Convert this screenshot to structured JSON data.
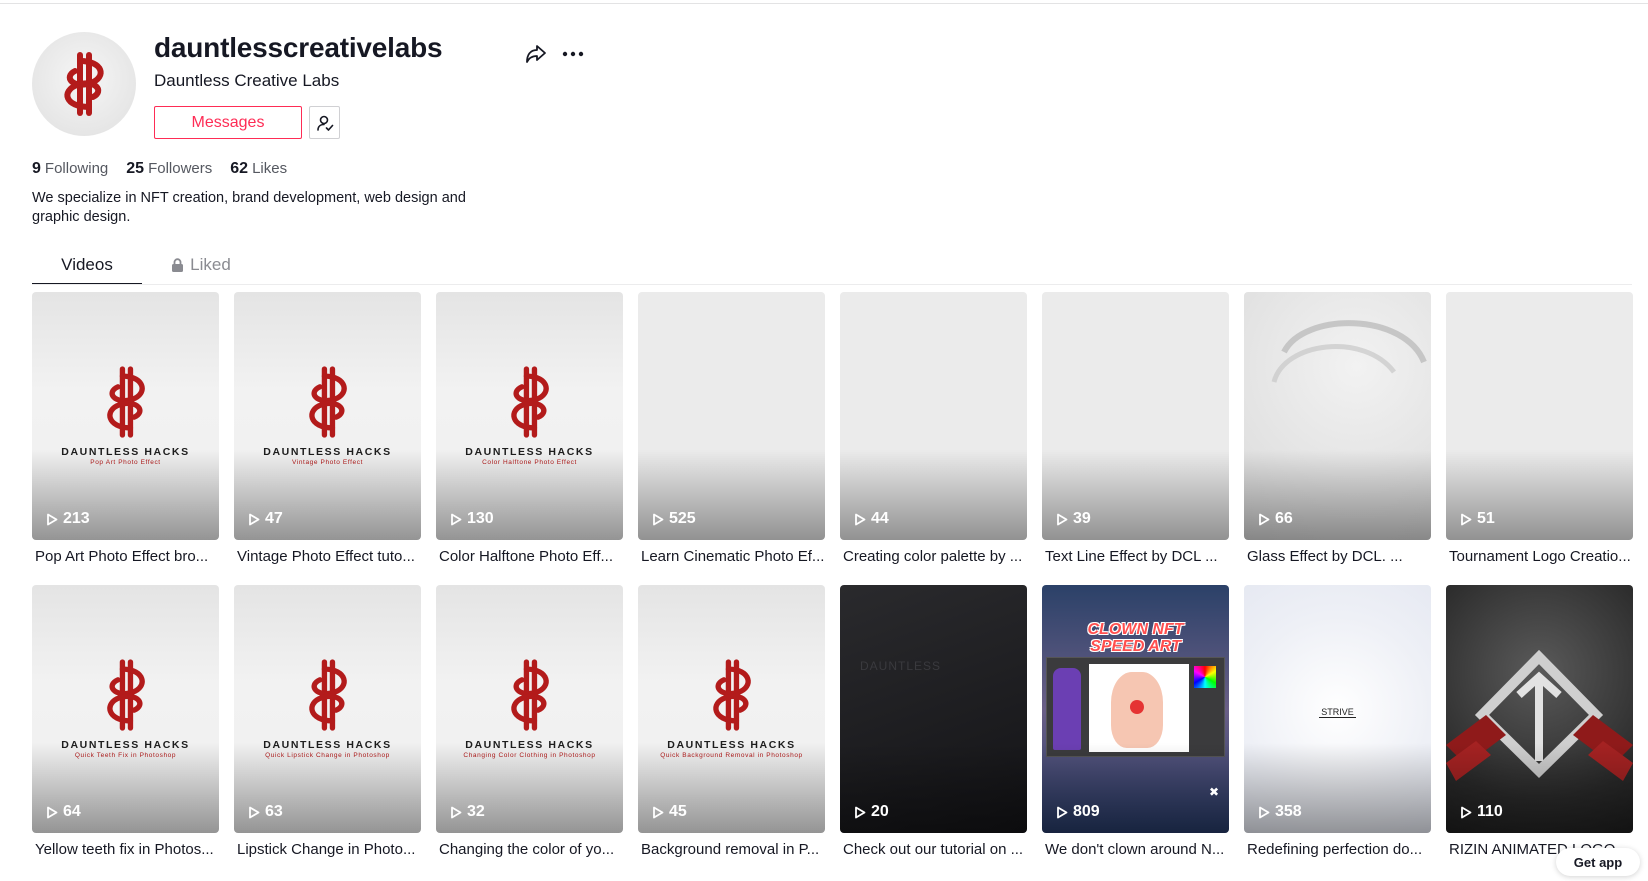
{
  "profile": {
    "username": "dauntlesscreativelabs",
    "display_name": "Dauntless Creative Labs",
    "messages_label": "Messages",
    "stats": {
      "following": {
        "count": "9",
        "label": "Following"
      },
      "followers": {
        "count": "25",
        "label": "Followers"
      },
      "likes": {
        "count": "62",
        "label": "Likes"
      }
    },
    "bio": "We specialize in NFT creation, brand development, web design and graphic design."
  },
  "tabs": {
    "videos": "Videos",
    "liked": "Liked"
  },
  "videos": [
    {
      "views": "213",
      "caption": "Pop Art Photo Effect bro...",
      "thumb": "light",
      "brand": "DAUNTLESS HACKS",
      "subtitle": "Pop Art Photo Effect"
    },
    {
      "views": "47",
      "caption": "Vintage Photo Effect tuto...",
      "thumb": "light",
      "brand": "DAUNTLESS HACKS",
      "subtitle": "Vintage Photo Effect"
    },
    {
      "views": "130",
      "caption": "Color Halftone Photo Eff...",
      "thumb": "light",
      "brand": "DAUNTLESS HACKS",
      "subtitle": "Color Halftone Photo Effect"
    },
    {
      "views": "525",
      "caption": "Learn Cinematic Photo Ef...",
      "thumb": "blank"
    },
    {
      "views": "44",
      "caption": "Creating color palette by ...",
      "thumb": "blank"
    },
    {
      "views": "39",
      "caption": "Text Line Effect by DCL ...",
      "thumb": "blank"
    },
    {
      "views": "66",
      "caption": "Glass Effect by DCL. ...",
      "thumb": "glass"
    },
    {
      "views": "51",
      "caption": "Tournament Logo Creatio...",
      "thumb": "blank"
    },
    {
      "views": "64",
      "caption": "Yellow teeth fix in Photos...",
      "thumb": "light",
      "brand": "DAUNTLESS HACKS",
      "subtitle": "Quick Teeth Fix in Photoshop"
    },
    {
      "views": "63",
      "caption": "Lipstick Change in Photo...",
      "thumb": "light",
      "brand": "DAUNTLESS HACKS",
      "subtitle": "Quick Lipstick Change in Photoshop"
    },
    {
      "views": "32",
      "caption": "Changing the color of yo...",
      "thumb": "light",
      "brand": "DAUNTLESS HACKS",
      "subtitle": "Changing Color Clothing in Photoshop"
    },
    {
      "views": "45",
      "caption": "Background removal in P...",
      "thumb": "light",
      "brand": "DAUNTLESS HACKS",
      "subtitle": "Quick Background Removal in Photoshop"
    },
    {
      "views": "20",
      "caption": "Check out our tutorial on ...",
      "thumb": "dark",
      "overlay": "DAUNTLESS"
    },
    {
      "views": "809",
      "caption": "We don't clown around N...",
      "thumb": "clown",
      "overlay_line1": "CLOWN NFT",
      "overlay_line2": "SPEED ART"
    },
    {
      "views": "358",
      "caption": "Redefining perfection do...",
      "thumb": "strive",
      "overlay": "STRIVE"
    },
    {
      "views": "110",
      "caption": "RIZIN ANIMATED LOGO",
      "thumb": "rizin"
    }
  ],
  "get_app_label": "Get app",
  "colors": {
    "accent": "#fe2c55",
    "text": "#161823",
    "logo_red": "#b31b1b"
  }
}
